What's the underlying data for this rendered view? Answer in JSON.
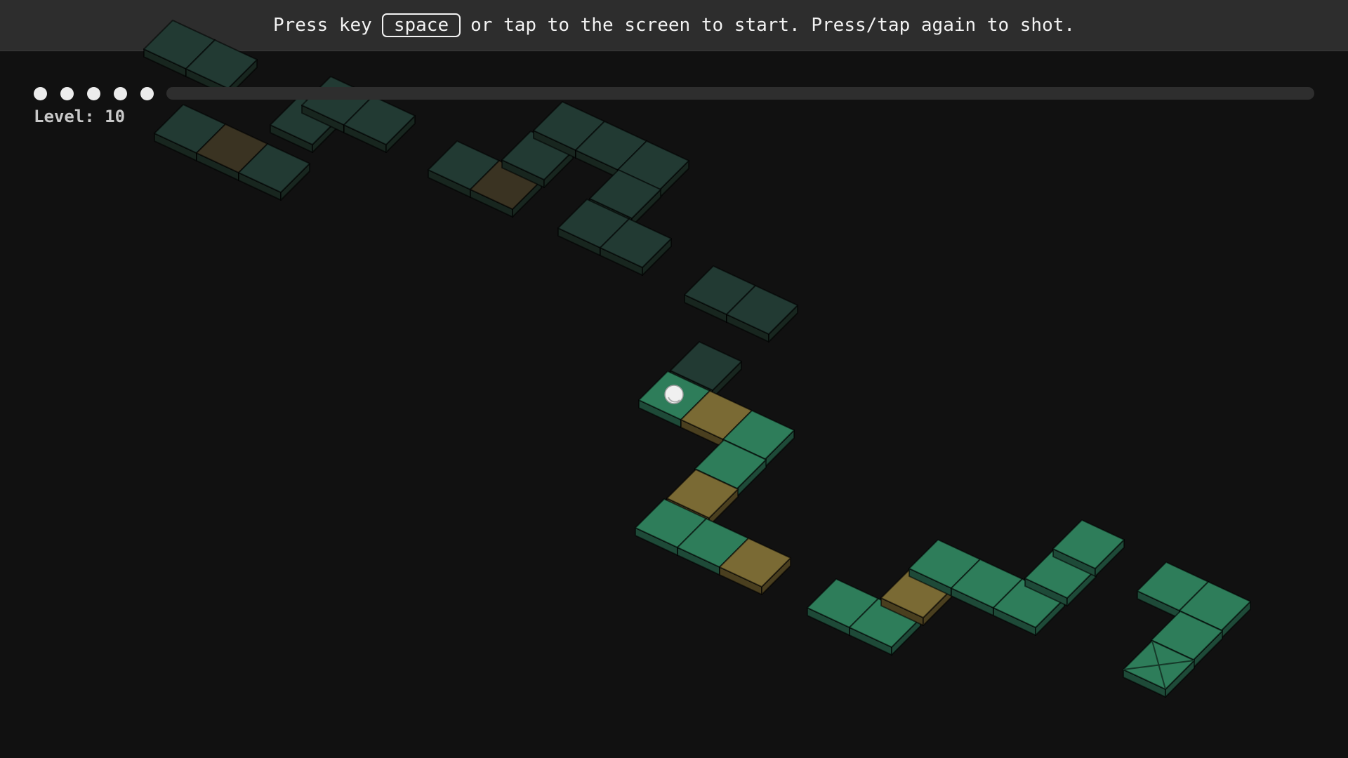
{
  "instructions": {
    "before": "Press key",
    "key": "space",
    "after": "or tap to the screen to start. Press/tap again to shot."
  },
  "hud": {
    "lives_remaining": 5,
    "level_text": "Level: 10",
    "progress": 0
  },
  "colors": {
    "background": "#111111",
    "tile_active": "#2e7d5a",
    "tile_active_side": "#1e4a38",
    "tile_special": "#7a6a34",
    "tile_special_side": "#4a3f1f",
    "tile_passed": "#223a33",
    "tile_passed_side": "#18261f",
    "tile_passed_special": "#3a3322",
    "ball": "#f0f0f0",
    "goal_mark": "#163a2a"
  }
}
